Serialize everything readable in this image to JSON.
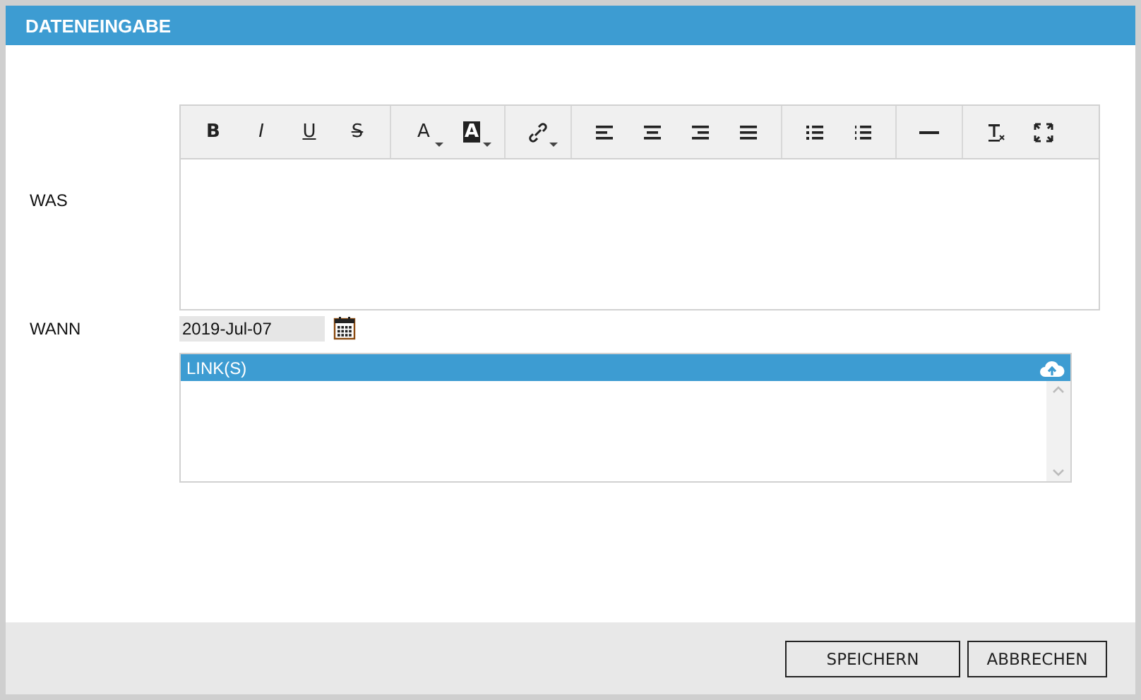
{
  "dialog": {
    "title": "DATENEINGABE"
  },
  "what": {
    "label": "WAS"
  },
  "toolbar": [
    [
      {
        "kind": "bold",
        "label": "B"
      },
      {
        "kind": "italic",
        "label": "I"
      },
      {
        "kind": "underline",
        "label": "U"
      },
      {
        "kind": "strike",
        "label": "S"
      }
    ],
    [
      {
        "kind": "text-color",
        "label": "A"
      },
      {
        "kind": "background-color",
        "label": "A"
      }
    ],
    [
      {
        "kind": "link"
      }
    ],
    [
      {
        "kind": "align-left"
      },
      {
        "kind": "align-center"
      },
      {
        "kind": "align-right"
      },
      {
        "kind": "justify"
      }
    ],
    [
      {
        "kind": "bullet-list"
      },
      {
        "kind": "numbered-list"
      }
    ],
    [
      {
        "kind": "horizontal-rule"
      }
    ],
    [
      {
        "kind": "clear-format"
      },
      {
        "kind": "fullscreen"
      }
    ]
  ],
  "when": {
    "label": "WANN",
    "value": "2019-Jul-07"
  },
  "links": {
    "title": "LINK(S)"
  },
  "buttons": [
    {
      "label": "SPEICHERN"
    },
    {
      "label": "ABBRECHEN"
    }
  ]
}
